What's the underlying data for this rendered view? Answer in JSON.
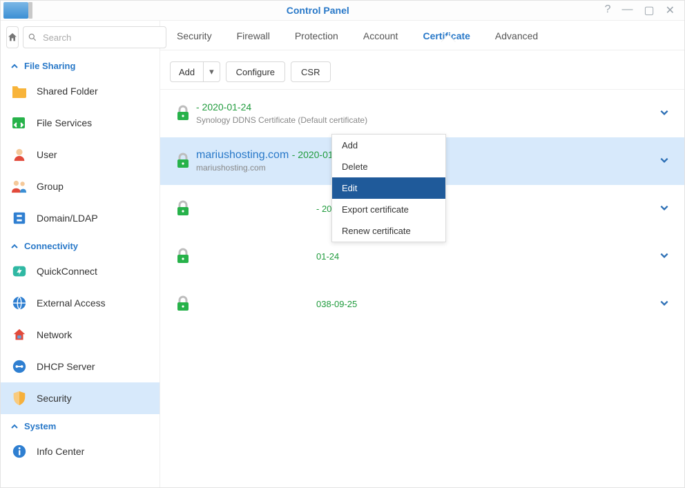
{
  "window": {
    "title": "Control Panel"
  },
  "search": {
    "placeholder": "Search"
  },
  "sidebar": {
    "categories": [
      {
        "label": "File Sharing",
        "items": [
          {
            "label": "Shared Folder",
            "icon": "folder-icon"
          },
          {
            "label": "File Services",
            "icon": "file-services-icon"
          },
          {
            "label": "User",
            "icon": "user-icon"
          },
          {
            "label": "Group",
            "icon": "group-icon"
          },
          {
            "label": "Domain/LDAP",
            "icon": "domain-ldap-icon"
          }
        ]
      },
      {
        "label": "Connectivity",
        "items": [
          {
            "label": "QuickConnect",
            "icon": "quickconnect-icon"
          },
          {
            "label": "External Access",
            "icon": "external-access-icon"
          },
          {
            "label": "Network",
            "icon": "network-icon"
          },
          {
            "label": "DHCP Server",
            "icon": "dhcp-icon"
          },
          {
            "label": "Security",
            "icon": "security-icon",
            "selected": true
          }
        ]
      },
      {
        "label": "System",
        "items": [
          {
            "label": "Info Center",
            "icon": "info-icon"
          }
        ]
      }
    ]
  },
  "tabs": [
    "Security",
    "Firewall",
    "Protection",
    "Account",
    "Certificate",
    "Advanced"
  ],
  "active_tab": "Certificate",
  "toolbar": {
    "add": "Add",
    "configure": "Configure",
    "csr": "CSR"
  },
  "certificates": [
    {
      "title": "",
      "date": " - 2020-01-24",
      "sub": "Synology DDNS Certificate (Default certificate)",
      "lock": "green"
    },
    {
      "title": "mariushosting.com",
      "date": " - 2020-01-24",
      "sub": "mariushosting.com",
      "lock": "green",
      "selected": true
    },
    {
      "title": "",
      "date": " - 2020-01-24",
      "sub": "",
      "lock": "green"
    },
    {
      "title": "",
      "date": "01-24",
      "sub": "",
      "lock": "green"
    },
    {
      "title": "",
      "date": "038-09-25",
      "sub": "",
      "lock": "green"
    }
  ],
  "context_menu": {
    "items": [
      "Add",
      "Delete",
      "Edit",
      "Export certificate",
      "Renew certificate"
    ],
    "highlighted": "Edit"
  }
}
